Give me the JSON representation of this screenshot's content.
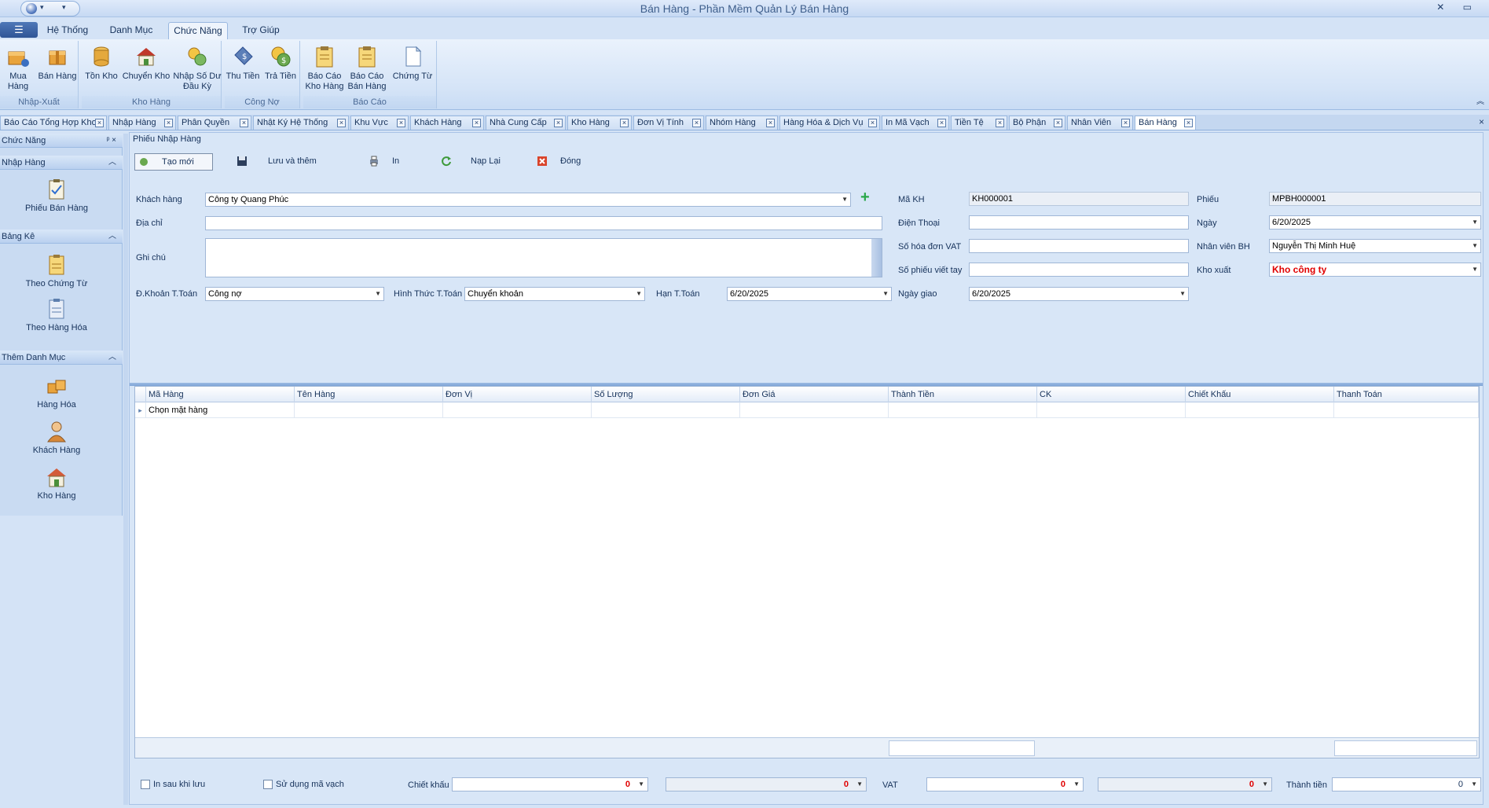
{
  "window": {
    "title": "Bán Hàng - Phần Mềm Quản Lý Bán Hàng",
    "controls": "✕ ▭"
  },
  "ribbon_tabs": [
    "Hệ Thống",
    "Danh Mục",
    "Chức Năng",
    "Trợ Giúp"
  ],
  "ribbon": {
    "groups": [
      {
        "label": "Nhập-Xuất",
        "buttons": [
          "Mua Hàng",
          "Bán Hàng"
        ]
      },
      {
        "label": "Kho Hàng",
        "buttons": [
          "Tồn Kho",
          "Chuyển Kho",
          "Nhập Số Dư Đầu Kỳ"
        ]
      },
      {
        "label": "Công Nợ",
        "buttons": [
          "Thu Tiền",
          "Trả Tiền"
        ]
      },
      {
        "label": "Báo Cáo",
        "buttons": [
          "Báo Cáo Kho Hàng",
          "Báo Cáo Bán Hàng",
          "Chứng Từ"
        ]
      }
    ]
  },
  "doc_tabs": [
    "Báo Cáo Tổng Hợp Kho",
    "Nhập Hàng",
    "Phân Quyền",
    "Nhật Ký Hệ Thống",
    "Khu Vực",
    "Khách Hàng",
    "Nhà Cung Cấp",
    "Kho Hàng",
    "Đơn Vị Tính",
    "Nhóm Hàng",
    "Hàng Hóa & Dịch Vụ",
    "In Mã Vạch",
    "Tiền Tệ",
    "Bộ Phận",
    "Nhân Viên",
    "Bán Hàng"
  ],
  "left_nav": {
    "title": "Chức Năng",
    "sections": [
      {
        "title": "Nhập Hàng",
        "items": [
          "Phiếu Bán Hàng"
        ]
      },
      {
        "title": "Bảng Kê",
        "items": [
          "Theo Chứng Từ",
          "Theo Hàng Hóa"
        ]
      },
      {
        "title": "Thêm Danh Mục",
        "items": [
          "Hàng Hóa",
          "Khách Hàng",
          "Kho Hàng"
        ]
      }
    ]
  },
  "form": {
    "panel_title": "Phiếu Nhập Hàng",
    "toolbar": [
      "Tạo mới",
      "Lưu và thêm",
      "In",
      "Nạp Lại",
      "Đóng"
    ],
    "labels": {
      "khach_hang": "Khách hàng",
      "dia_chi": "Địa chỉ",
      "ghi_chu": "Ghi chú",
      "dk_toan": "Đ.Khoản T.Toán",
      "hinh_thuc": "Hình Thức T.Toán",
      "han_toan": "Hạn T.Toán",
      "ma_kh": "Mã KH",
      "dien_thoai": "Điện Thoại",
      "so_hd_vat": "Số hóa đơn VAT",
      "so_phieu_viet_tay": "Số phiếu viết tay",
      "ngay_giao": "Ngày giao",
      "phieu": "Phiếu",
      "ngay": "Ngày",
      "nhan_vien_bh": "Nhân viên BH",
      "kho_xuat": "Kho xuất"
    },
    "values": {
      "khach_hang": "Công ty Quang Phúc",
      "dia_chi": "",
      "ghi_chu": "",
      "dk_toan": "Công nợ",
      "hinh_thuc": "Chuyển khoản",
      "han_toan": "6/20/2025",
      "ma_kh": "KH000001",
      "dien_thoai": "",
      "so_hd_vat": "",
      "so_phieu_viet_tay": "",
      "ngay_giao": "6/20/2025",
      "phieu": "MPBH000001",
      "ngay": "6/20/2025",
      "nhan_vien_bh": "Nguyễn Thị Minh  Huệ",
      "kho_xuat": "Kho công ty"
    }
  },
  "grid": {
    "columns": [
      "Mã Hàng",
      "Tên Hàng",
      "Đơn Vị",
      "Số Lượng",
      "Đơn Giá",
      "Thành Tiền",
      "CK",
      "Chiết Khấu",
      "Thanh Toán"
    ],
    "new_row_text": "Chọn mặt hàng"
  },
  "bottom": {
    "in_sau_khi_luu": "In sau khi lưu",
    "su_dung_ma_vach": "Sử dụng mã vạch",
    "chiet_khau_label": "Chiết khấu",
    "chiet_khau": "0",
    "chiet_khau_amount": "0",
    "vat_label": "VAT",
    "vat": "0",
    "vat_amount": "0",
    "thanh_tien_label": "Thành tiền",
    "thanh_tien": "0"
  },
  "colors": {
    "accent": "#2f5596",
    "required_red": "#e00000",
    "add_green": "#2aa84a"
  }
}
